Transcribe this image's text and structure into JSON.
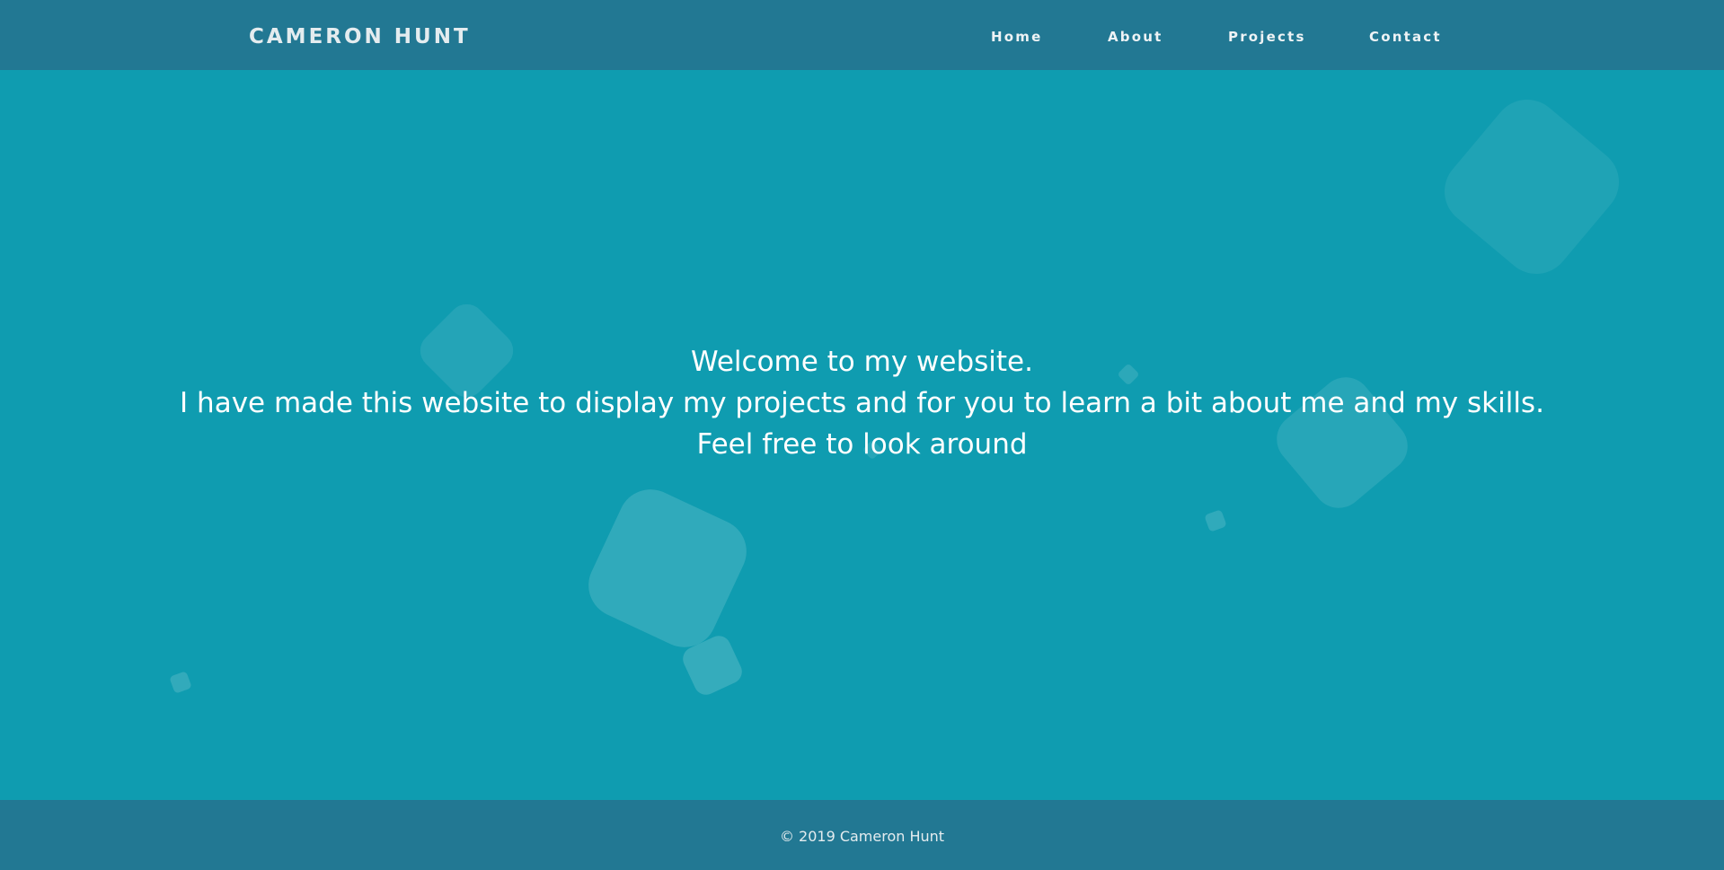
{
  "header": {
    "brand": "CAMERON HUNT",
    "nav": [
      {
        "label": "Home"
      },
      {
        "label": "About"
      },
      {
        "label": "Projects"
      },
      {
        "label": "Contact"
      }
    ]
  },
  "hero": {
    "lines": [
      "Welcome to my website.",
      "I have made this website to display my projects and for you to learn a bit about me and my skills.",
      "Feel free to look around"
    ]
  },
  "footer": {
    "copyright": "© 2019 Cameron Hunt"
  },
  "colors": {
    "header_bg": "#227893",
    "hero_bg": "#0f9cb0",
    "footer_bg": "#227893",
    "text": "#ffffff"
  }
}
